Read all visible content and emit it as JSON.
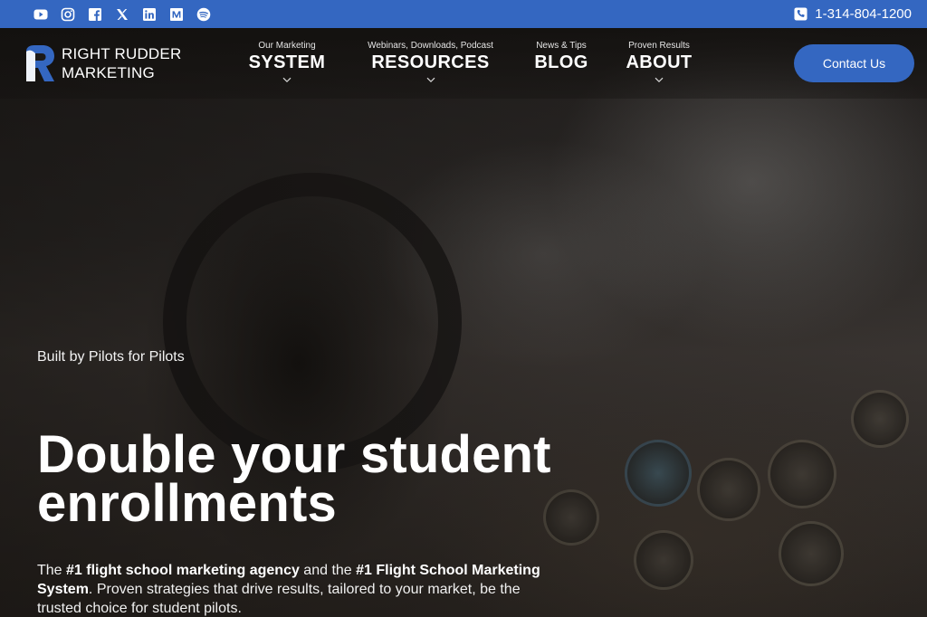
{
  "topbar": {
    "socials": [
      {
        "icon": "youtube-icon"
      },
      {
        "icon": "instagram-icon"
      },
      {
        "icon": "facebook-icon"
      },
      {
        "icon": "x-twitter-icon"
      },
      {
        "icon": "linkedin-icon"
      },
      {
        "icon": "medium-icon"
      },
      {
        "icon": "spotify-icon"
      }
    ],
    "phone": "1-314-804-1200",
    "background": "#3467c1"
  },
  "logo": {
    "line1": "RIGHT RUDDER",
    "line2": "MARKETING"
  },
  "nav": {
    "items": [
      {
        "sub": "Our Marketing",
        "label": "SYSTEM",
        "has_dropdown": true
      },
      {
        "sub": "Webinars, Downloads, Podcast",
        "label": "RESOURCES",
        "has_dropdown": true
      },
      {
        "sub": "News & Tips",
        "label": "BLOG",
        "has_dropdown": false
      },
      {
        "sub": "Proven Results",
        "label": "ABOUT",
        "has_dropdown": true
      }
    ],
    "contact_label": "Contact Us"
  },
  "hero": {
    "eyebrow": "Built by Pilots for Pilots",
    "headline": "Double your student enrollments",
    "lead": {
      "t1": "The ",
      "b1": "#1 flight school marketing agency",
      "t2": " and the ",
      "b2": "#1 Flight School Marketing System",
      "t3": ". Proven strategies that drive results, tailored to your market, be the trusted choice for student pilots."
    }
  },
  "colors": {
    "accent": "#3467c1",
    "text": "#ffffff"
  }
}
